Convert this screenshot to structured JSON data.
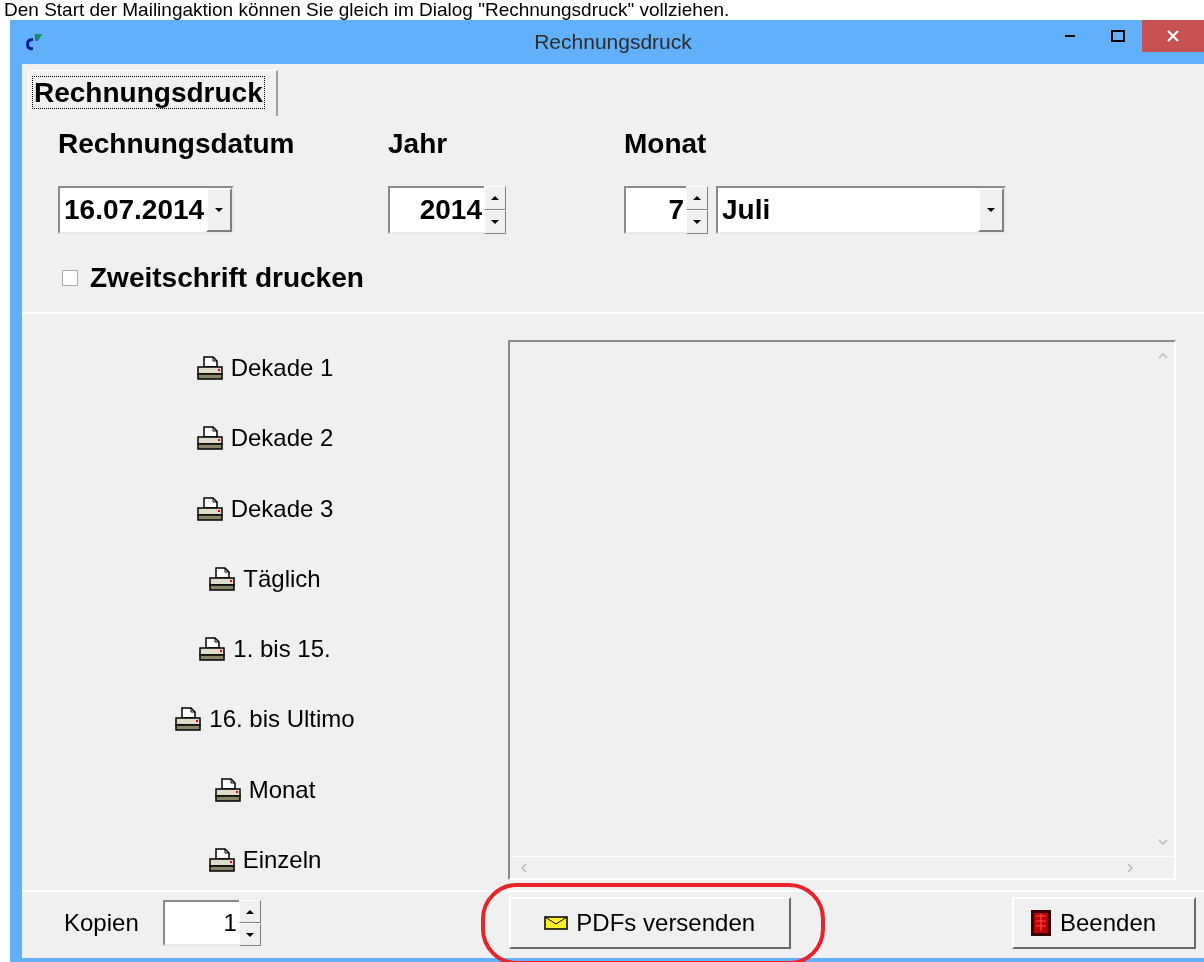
{
  "caption": "Den Start der Mailingaktion können Sie gleich im Dialog \"Rechnungsdruck\" vollziehen.",
  "window": {
    "title": "Rechnungsdruck"
  },
  "tabs": [
    {
      "label": "Rechnungsdruck",
      "selected": true
    }
  ],
  "fields": [
    {
      "kind": "date",
      "label": "Rechnungsdatum",
      "value": "16.07.2014"
    },
    {
      "kind": "spin",
      "label": "Jahr",
      "value": "2014"
    },
    {
      "kind": "spin",
      "label": "Monat",
      "value": "7"
    },
    {
      "kind": "combo",
      "value": "Juli"
    }
  ],
  "duplicate_checkbox": {
    "label": "Zweitschrift drucken",
    "checked": false
  },
  "print_buttons": [
    {
      "label": "Dekade 1"
    },
    {
      "label": "Dekade 2"
    },
    {
      "label": "Dekade 3"
    },
    {
      "label": "Täglich"
    },
    {
      "label": "1. bis 15."
    },
    {
      "label": "16. bis Ultimo"
    },
    {
      "label": "Monat"
    },
    {
      "label": "Einzeln"
    }
  ],
  "footer": {
    "copies_label": "Kopien",
    "copies_value": "1",
    "send_button": {
      "label": "PDFs versenden",
      "highlighted": true
    },
    "exit_button": {
      "label": "Beenden"
    }
  }
}
